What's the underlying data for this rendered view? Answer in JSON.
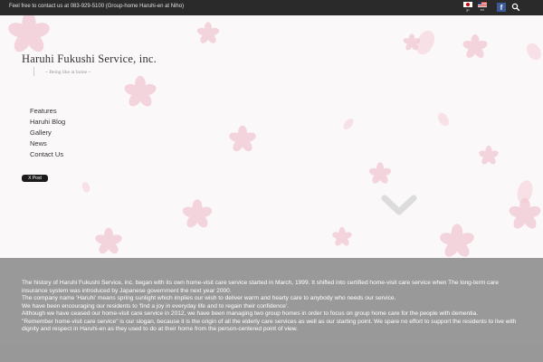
{
  "topbar": {
    "contact_text": "Feel free to contact us at 083-929-5100 (Group-home Haruhi-en at Niho)",
    "languages": [
      {
        "code": "jp",
        "flag_icon": "japan-flag-icon"
      },
      {
        "code": "en",
        "flag_icon": "us-flag-icon"
      }
    ],
    "facebook_glyph": "f",
    "facebook_color": "#3b5998"
  },
  "header": {
    "site_title": "Haruhi Fukushi Service, inc.",
    "tagline": "~ Being like at home ~"
  },
  "nav": {
    "items": [
      "Features",
      "Haruhi Blog",
      "Gallery",
      "News",
      "Contact Us"
    ]
  },
  "social": {
    "post_button_label": "X Post"
  },
  "about": {
    "paragraphs": [
      "The history of Haruhi Fukushi Service, inc. began with its own home-visit care service started in March, 1999. It shifted into certified home-visit care service when The long-term care insurance system was introduced by Japanese government the next year 2000.",
      "The company name 'Haruhi' means spring sunlight which implies our wish to deliver warm and hearty care to anybody who needs our service.",
      "We have been encouraging our residents to 'find a joy in everyday life and to regain their confidence'.",
      "Although we have ceased our home-visit care service in 2012, we have been managing two group homes in order to focus on group home care for the people with dementia.",
      "\"Remember home-visit care service\" is our slogan, because it is the origin of all the elderly care services as well as our starting point. We spare no effort to support the residents to live with dignity and respect in Haruhi-en as they used to do at their home from the person-centered point of view."
    ]
  },
  "colors": {
    "topbar": "#2a2a2a",
    "petal": "#f2c9d3",
    "overlay": "#919191",
    "chevron": "#dcdcdc"
  }
}
